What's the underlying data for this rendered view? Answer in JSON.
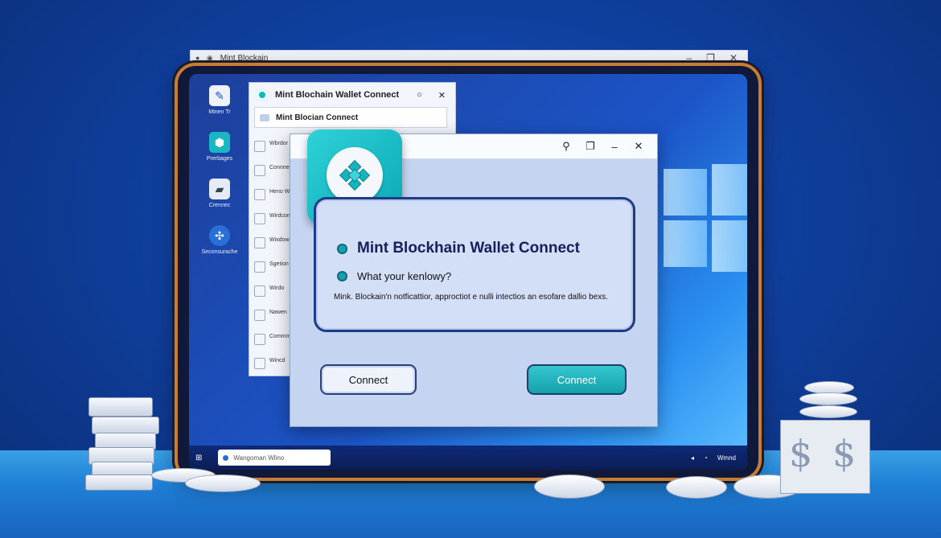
{
  "background_window": {
    "title": "Mint Blockain",
    "controls": [
      "–",
      "❐",
      "✕"
    ]
  },
  "desktop_icons": [
    {
      "label": "Minen Tr",
      "icon": "document-icon"
    },
    {
      "label": "Prerbages",
      "icon": "hexagon-icon"
    },
    {
      "label": "Crennec",
      "icon": "folder-icon"
    },
    {
      "label": "Seconsurache",
      "icon": "network-icon"
    }
  ],
  "side_panel": {
    "title": "Mint Blochain Wallet Connect",
    "subtitle": "Mint Blocian Connect",
    "controls": [
      "○",
      "✕"
    ],
    "items": [
      {
        "label": "Wbrdor"
      },
      {
        "label": "Connnect"
      },
      {
        "label": "Heno W"
      },
      {
        "label": "Wirdcon"
      },
      {
        "label": "Wixdow"
      },
      {
        "label": "Sgetion"
      },
      {
        "label": "Wirdo"
      },
      {
        "label": "Nawen"
      },
      {
        "label": "Commm"
      },
      {
        "label": "Wincd"
      }
    ]
  },
  "taskbar": {
    "search_text": "Wangoman Wlino",
    "tray_text": "Wmnd"
  },
  "dialog": {
    "controls": [
      "⚲",
      "❐",
      "–",
      "✕"
    ],
    "title": "Mint Blockhain Wallet Connect",
    "question": "What your kenlowy?",
    "body": "Mink. Blockain'n notficattior, approctiot e nulli intectios an esofare dallio bexs.",
    "buttons": {
      "secondary": "Connect",
      "primary": "Connect"
    }
  },
  "colors": {
    "accent": "#14a2b1",
    "dialog_bg": "#c5d4f0",
    "screen": "#1c54c7"
  }
}
